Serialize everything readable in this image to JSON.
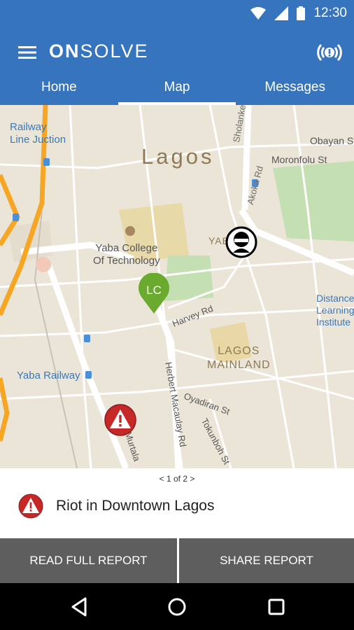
{
  "status_bar": {
    "time": "12:30",
    "icons": [
      "wifi-icon",
      "signal-icon",
      "battery-icon"
    ]
  },
  "app_bar": {
    "brand_on": "ON",
    "brand_solve": "SOLVE",
    "menu_icon": "hamburger-menu-icon",
    "alert_icon": "broadcast-alert-icon"
  },
  "tabs": [
    {
      "label": "Home",
      "active": false
    },
    {
      "label": "Map",
      "active": true
    },
    {
      "label": "Messages",
      "active": false
    }
  ],
  "map": {
    "labels": {
      "railway_line_junction": "Railway\nLine Juction",
      "city": "Lagos",
      "sholanke": "Sholanke St",
      "obayan": "Obayan St",
      "moronfolu": "Moronfolu St",
      "akoka": "Akoka Rd",
      "yaba_short": "YAB",
      "yaba_college": "Yaba College\nOf Technology",
      "harvey": "Harvey Rd",
      "distance_learning": "Distance\nLearning\nInstitute",
      "lagos_mainland": "LAGOS\nMAINLAND",
      "yaba_railway": "Yaba Railway",
      "herbert": "Herbert Macaulay Rd",
      "oyadiran": "Oyadiran St",
      "tokunboh": "Tokunboh St",
      "murtala": "Murtala"
    },
    "markers": [
      {
        "type": "location",
        "label": "LC",
        "color": "#6aab2f"
      },
      {
        "type": "masked-person",
        "color": "#000000"
      },
      {
        "type": "alert",
        "color": "#c62828"
      }
    ],
    "colors": {
      "land": "#ebe5d8",
      "highway": "#f6a623",
      "road": "#ffffff",
      "park": "#c4dfb1",
      "campus": "#e8d9a8"
    }
  },
  "report": {
    "pager": "< 1 of 2 >",
    "title": "Riot in Downtown Lagos",
    "icon": "alert-icon"
  },
  "actions": {
    "read_label": "READ FULL REPORT",
    "share_label": "SHARE REPORT"
  },
  "nav": {
    "back": "back-triangle-icon",
    "home": "home-circle-icon",
    "recents": "recents-square-icon"
  }
}
